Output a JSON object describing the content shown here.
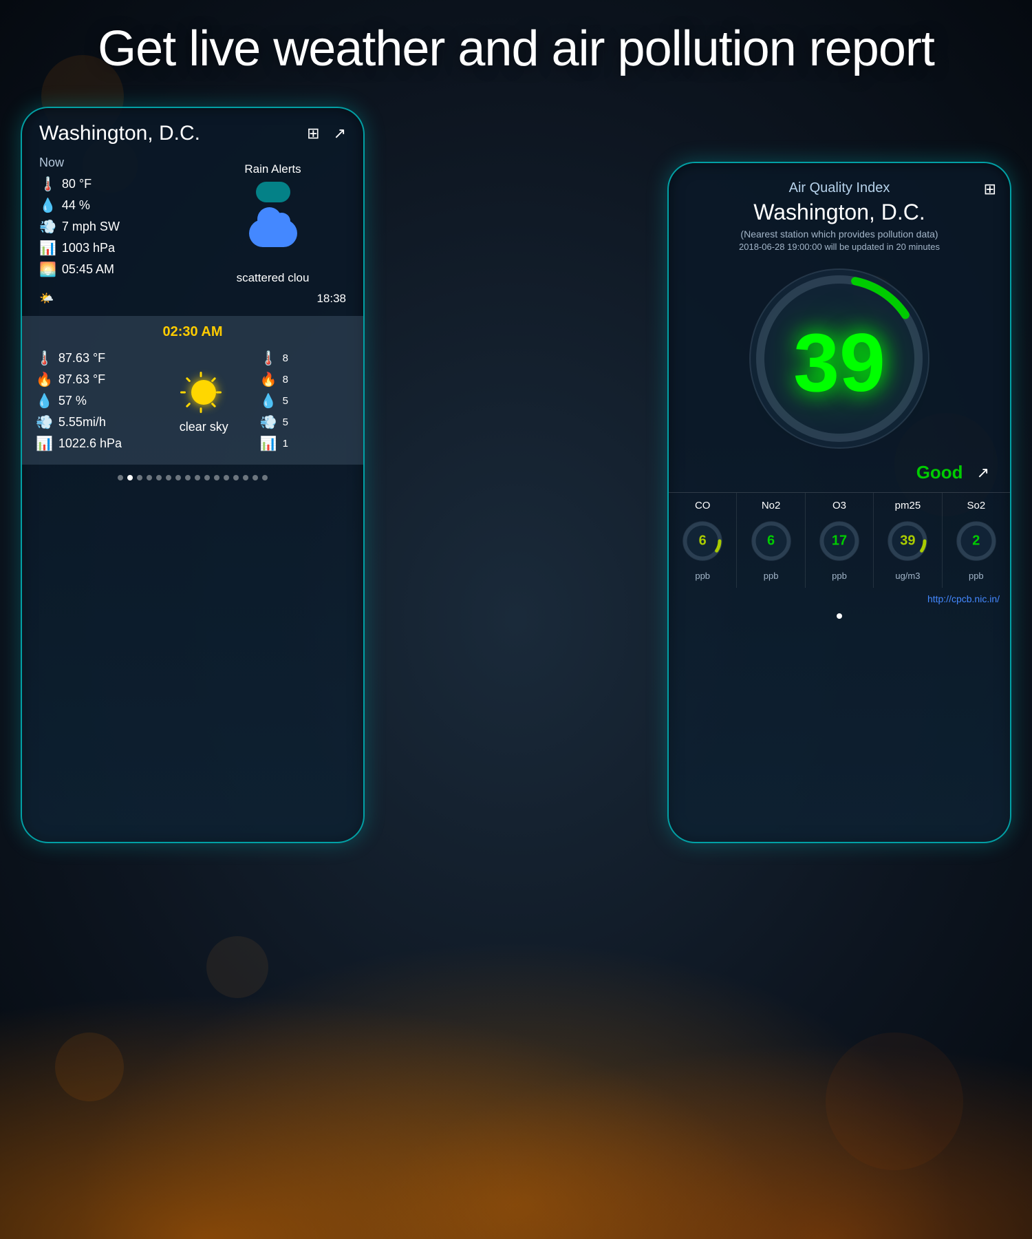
{
  "page": {
    "title": "Get live weather and air pollution report",
    "bg_color": "#0d1520"
  },
  "weather_card": {
    "city": "Washington, D.C.",
    "current_label": "Now",
    "temp": "80 °F",
    "humidity": "44 %",
    "wind": "7 mph SW",
    "pressure": "1003 hPa",
    "sunrise": "05:45 AM",
    "sunset": "18:38",
    "rain_alerts": "Rain Alerts",
    "condition": "scattered clou",
    "forecast_time": "02:30 AM",
    "forecast_temp1": "87.63 °F",
    "forecast_temp2": "87.63 °F",
    "forecast_humidity": "57 %",
    "forecast_wind": "5.55mi/h",
    "forecast_pressure": "1022.6 hPa",
    "forecast_condition": "clear sky",
    "forecast_right1": "8",
    "forecast_right2": "8",
    "forecast_right3": "5",
    "forecast_right4": "5",
    "forecast_right5": "1"
  },
  "aqi_card": {
    "title": "Air Quality Index",
    "city": "Washington, D.C.",
    "station_note": "(Nearest station which provides pollution data)",
    "timestamp": "2018-06-28 19:00:00 will be updated in 20 minutes",
    "aqi_value": "39",
    "status": "Good",
    "pollutants": [
      {
        "name": "CO",
        "value": "6",
        "unit": "ppb",
        "color": "yellow"
      },
      {
        "name": "No2",
        "value": "6",
        "unit": "ppb",
        "color": "green"
      },
      {
        "name": "O3",
        "value": "17",
        "unit": "ppb",
        "color": "green"
      },
      {
        "name": "pm25",
        "value": "39",
        "unit": "ug/m3",
        "color": "yellow"
      },
      {
        "name": "So2",
        "value": "2",
        "unit": "ppb",
        "color": "green"
      }
    ],
    "cpcb_link": "http://cpcb.nic.in/",
    "pagination_dot": "●"
  },
  "icons": {
    "grid": "⊞",
    "share": "⎋",
    "share_aqi": "⎋"
  },
  "pagination": {
    "dots": [
      0,
      1,
      2,
      3,
      4,
      5,
      6,
      7,
      8,
      9,
      10,
      11,
      12,
      13,
      14,
      15
    ],
    "active_index": 1
  }
}
